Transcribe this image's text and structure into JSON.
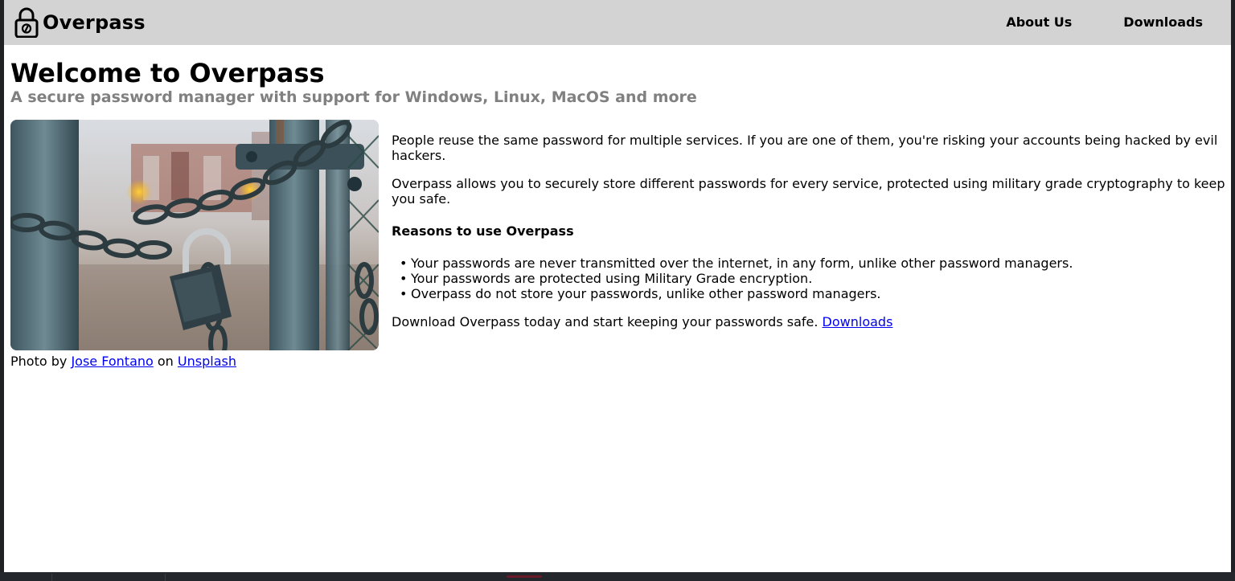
{
  "nav": {
    "brand": "Overpass",
    "brand_icon": "lock-icon",
    "links": [
      {
        "label": "About Us"
      },
      {
        "label": "Downloads"
      }
    ]
  },
  "header": {
    "title": "Welcome to Overpass",
    "subtitle": "A secure password manager with support for Windows, Linux, MacOS and more"
  },
  "photo": {
    "caption_prefix": "Photo by",
    "author": "Jose Fontano",
    "caption_middle": "on",
    "source": "Unsplash"
  },
  "main": {
    "paragraph1": "People reuse the same password for multiple services. If you are one of them, you're risking your accounts being hacked by evil hackers.",
    "paragraph2": "Overpass allows you to securely store different passwords for every service, protected using military grade cryptography to keep you safe.",
    "reasons_heading": "Reasons to use Overpass",
    "reasons": [
      "Your passwords are never transmitted over the internet, in any form, unlike other password managers.",
      "Your passwords are protected using Military Grade encryption.",
      "Overpass do not store your passwords, unlike other password managers."
    ],
    "cta_text": "Download Overpass today and start keeping your passwords safe.",
    "cta_link": "Downloads"
  },
  "colors": {
    "navbar_bg": "#d3d3d3",
    "subtitle": "#808080",
    "link": "#0000ee"
  }
}
